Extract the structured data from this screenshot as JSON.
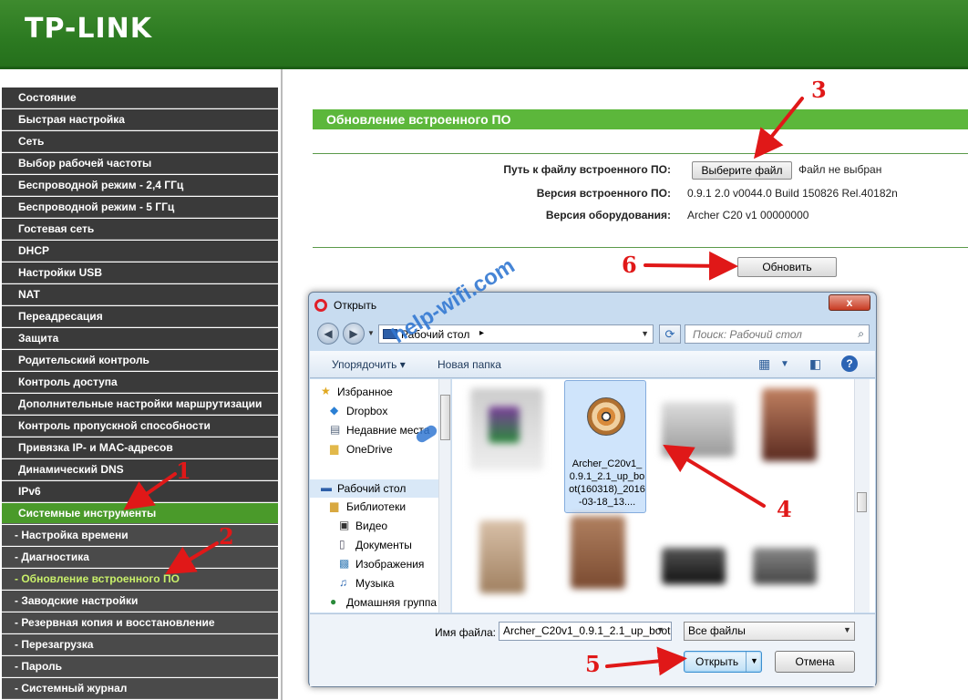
{
  "brand": {
    "logo": "TP-LINK"
  },
  "sidebar": {
    "items": [
      {
        "label": "Состояние",
        "kind": "main"
      },
      {
        "label": "Быстрая настройка",
        "kind": "main"
      },
      {
        "label": "Сеть",
        "kind": "main"
      },
      {
        "label": "Выбор рабочей частоты",
        "kind": "main"
      },
      {
        "label": "Беспроводной режим - 2,4 ГГц",
        "kind": "main"
      },
      {
        "label": "Беспроводной режим - 5 ГГц",
        "kind": "main"
      },
      {
        "label": "Гостевая сеть",
        "kind": "main"
      },
      {
        "label": "DHCP",
        "kind": "main"
      },
      {
        "label": "Настройки USB",
        "kind": "main"
      },
      {
        "label": "NAT",
        "kind": "main"
      },
      {
        "label": "Переадресация",
        "kind": "main"
      },
      {
        "label": "Защита",
        "kind": "main"
      },
      {
        "label": "Родительский контроль",
        "kind": "main"
      },
      {
        "label": "Контроль доступа",
        "kind": "main"
      },
      {
        "label": "Дополнительные настройки маршрутизации",
        "kind": "main"
      },
      {
        "label": "Контроль пропускной способности",
        "kind": "main"
      },
      {
        "label": "Привязка IP- и MAC-адресов",
        "kind": "main"
      },
      {
        "label": "Динамический DNS",
        "kind": "main"
      },
      {
        "label": "IPv6",
        "kind": "main"
      },
      {
        "label": "Системные инструменты",
        "kind": "active"
      },
      {
        "label": "- Настройка времени",
        "kind": "sub"
      },
      {
        "label": "- Диагностика",
        "kind": "sub"
      },
      {
        "label": "- Обновление встроенного ПО",
        "kind": "current"
      },
      {
        "label": "- Заводские настройки",
        "kind": "sub"
      },
      {
        "label": "- Резервная копия и восстановление",
        "kind": "sub"
      },
      {
        "label": "- Перезагрузка",
        "kind": "sub"
      },
      {
        "label": "- Пароль",
        "kind": "sub"
      },
      {
        "label": "- Системный журнал",
        "kind": "sub"
      }
    ]
  },
  "main": {
    "section_title": "Обновление встроенного ПО",
    "file_path_label": "Путь к файлу встроенного ПО:",
    "choose_file_button": "Выберите файл",
    "no_file_text": "Файл не выбран",
    "fw_version_label": "Версия встроенного ПО:",
    "fw_version_value": "0.9.1 2.0 v0044.0 Build 150826 Rel.40182n",
    "hw_version_label": "Версия оборудования:",
    "hw_version_value": "Archer C20 v1 00000000",
    "update_button": "Обновить"
  },
  "annotations": {
    "n1": "1",
    "n2": "2",
    "n3": "3",
    "n4": "4",
    "n5": "5",
    "n6": "6"
  },
  "dialog": {
    "title": "Открыть",
    "close_label": "x",
    "address": "Рабочий стол",
    "search_placeholder": "Поиск: Рабочий стол",
    "toolbar": {
      "organize": "Упорядочить",
      "new_folder": "Новая папка"
    },
    "tree": [
      {
        "label": "Избранное",
        "icon": "star-icon",
        "glyph": "★",
        "color": "#e0a820",
        "indent": 0
      },
      {
        "label": "Dropbox",
        "icon": "dropbox-icon",
        "glyph": "◆",
        "color": "#2a7fd4",
        "indent": 1
      },
      {
        "label": "Недавние места",
        "icon": "recent-places-icon",
        "glyph": "▤",
        "color": "#5a6a80",
        "indent": 1
      },
      {
        "label": "OneDrive",
        "icon": "onedrive-folder-icon",
        "glyph": "▆",
        "color": "#e2b84a",
        "indent": 1
      },
      {
        "label": "Рабочий стол",
        "icon": "desktop-icon",
        "glyph": "▬",
        "color": "#2e5fa8",
        "indent": 0
      },
      {
        "label": "Библиотеки",
        "icon": "libraries-icon",
        "glyph": "▆",
        "color": "#d8a840",
        "indent": 1
      },
      {
        "label": "Видео",
        "icon": "video-icon",
        "glyph": "▣",
        "color": "#333",
        "indent": 2
      },
      {
        "label": "Документы",
        "icon": "documents-icon",
        "glyph": "▯",
        "color": "#556",
        "indent": 2
      },
      {
        "label": "Изображения",
        "icon": "images-icon",
        "glyph": "▩",
        "color": "#3a7fb8",
        "indent": 2
      },
      {
        "label": "Музыка",
        "icon": "music-icon",
        "glyph": "♫",
        "color": "#2a66b0",
        "indent": 2
      },
      {
        "label": "Домашняя группа",
        "icon": "homegroup-icon",
        "glyph": "●",
        "color": "#2a8a3a",
        "indent": 1
      }
    ],
    "selected_file": "Archer_C20v1_0.9.1_2.1_up_boot(160318)_2016-03-18_13....",
    "filename_label": "Имя файла:",
    "filename_value": "Archer_C20v1_0.9.1_2.1_up_boot",
    "filetype": "Все файлы",
    "open_button": "Открыть",
    "cancel_button": "Отмена"
  },
  "watermark": "help-wifi.com",
  "colors": {
    "brand_green": "#2c7a21",
    "section_green": "#5cb73b",
    "annotation_red": "#e01818"
  }
}
